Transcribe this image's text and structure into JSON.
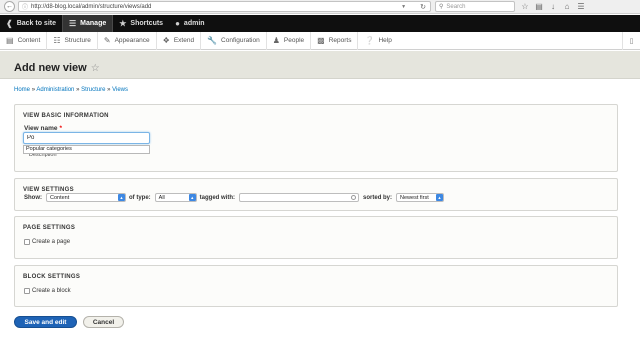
{
  "browser": {
    "url": "http://d8-blog.local/admin/structure/views/add",
    "search_placeholder": "Search"
  },
  "toolbar": {
    "back_label": "Back to site",
    "manage_label": "Manage",
    "shortcuts_label": "Shortcuts",
    "user_label": "admin"
  },
  "tray": {
    "items": [
      "Content",
      "Structure",
      "Appearance",
      "Extend",
      "Configuration",
      "People",
      "Reports",
      "Help"
    ]
  },
  "page": {
    "title": "Add new view",
    "breadcrumb": [
      "Home",
      "Administration",
      "Structure",
      "Views"
    ],
    "breadcrumb_sep": "»"
  },
  "basic": {
    "legend": "VIEW BASIC INFORMATION",
    "name_label": "View name",
    "required_mark": "*",
    "name_value": "Po",
    "autocomplete_option": "Popular categories",
    "description_label": "Description"
  },
  "view_settings": {
    "legend": "VIEW SETTINGS",
    "show_label": "Show:",
    "show_value": "Content",
    "of_type_label": "of type:",
    "type_value": "All",
    "tagged_label": "tagged with:",
    "sorted_label": "sorted by:",
    "sort_value": "Newest first"
  },
  "page_settings": {
    "legend": "PAGE SETTINGS",
    "checkbox_label": "Create a page"
  },
  "block_settings": {
    "legend": "BLOCK SETTINGS",
    "checkbox_label": "Create a block"
  },
  "actions": {
    "save_label": "Save and edit",
    "cancel_label": "Cancel"
  }
}
